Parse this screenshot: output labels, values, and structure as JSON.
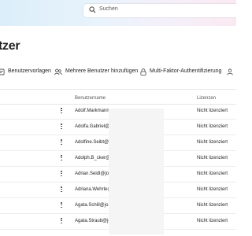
{
  "search": {
    "placeholder": "Suchen"
  },
  "page": {
    "title": "tzer"
  },
  "toolbar": {
    "items": [
      {
        "label": "Benutzervorlagen",
        "icon": "user-template-icon"
      },
      {
        "label": "Mehrere Benutzer hinzufügen",
        "icon": "add-users-icon"
      },
      {
        "label": "Multi-Faktor-Authentifizierung",
        "icon": "lock-icon"
      }
    ]
  },
  "table": {
    "columns": [
      "Benutzername",
      "Lizenzen"
    ],
    "rows": [
      {
        "username": "Adolf.Markmann",
        "license": "Nicht lizenziert"
      },
      {
        "username": "Adolfa.Gabriel@",
        "license": "Nicht lizenziert"
      },
      {
        "username": "Adolfine.Seibt@",
        "license": "Nicht lizenziert"
      },
      {
        "username": "Adolph.B_cker@",
        "license": "Nicht lizenziert"
      },
      {
        "username": "Adrian.Seidl@jo",
        "license": "Nicht lizenziert"
      },
      {
        "username": "Adriana.Wehrle@",
        "license": "Nicht lizenziert"
      },
      {
        "username": "Agata.Schill@jo",
        "license": "Nicht lizenziert"
      },
      {
        "username": "Agata.Straub@jo",
        "license": "Nicht lizenziert"
      }
    ]
  },
  "colors": {
    "background": "#ffffff",
    "text": "#242424",
    "icon": "#444444"
  }
}
